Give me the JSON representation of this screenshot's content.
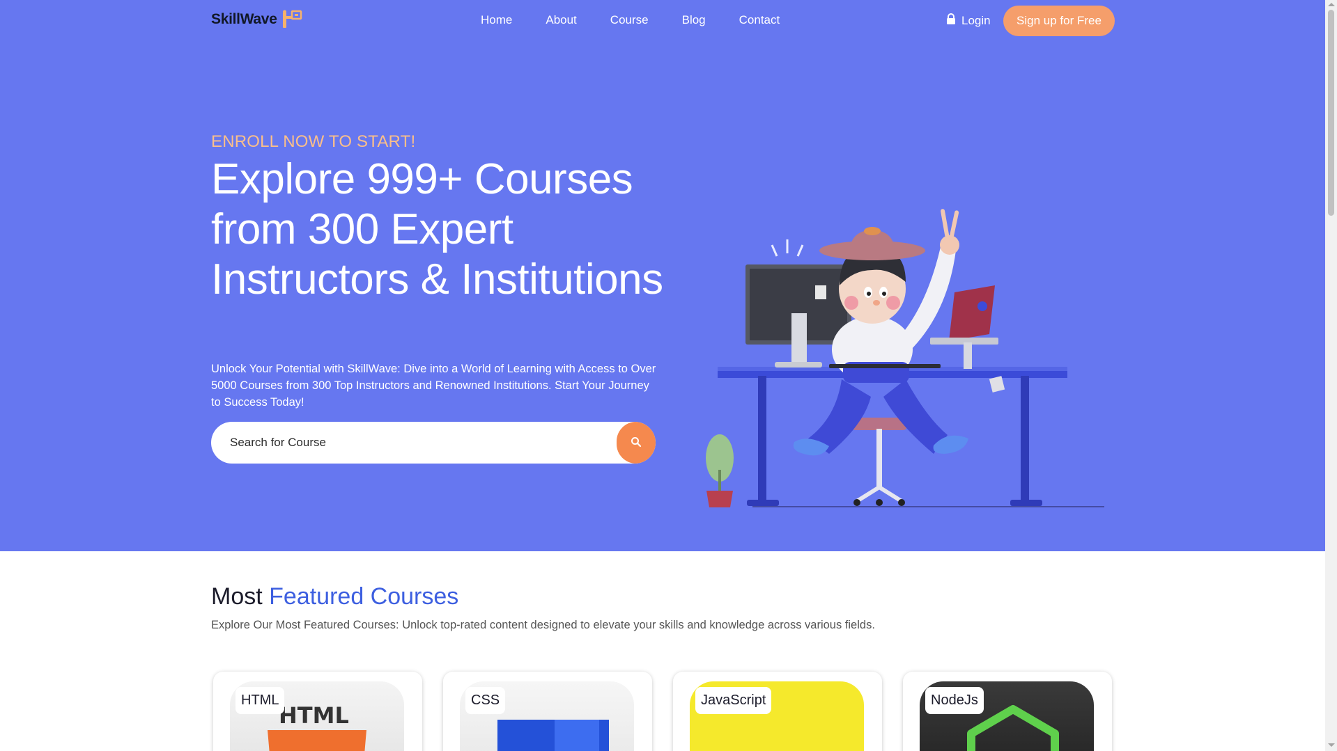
{
  "brand": {
    "name": "SkillWave",
    "color": "#111827"
  },
  "nav": {
    "links": [
      "Home",
      "About",
      "Course",
      "Blog",
      "Contact"
    ],
    "login_label": "Login",
    "signup_label": "Sign up for Free"
  },
  "hero": {
    "eyebrow": "ENROLL NOW TO START!",
    "headline": "Explore 999+ Courses from 300 Expert Instructors & Institutions",
    "subtext": "Unlock Your Potential with SkillWave: Dive into a World of Learning with Access to Over 5000 Courses from 300 Top Instructors and Renowned Institutions. Start Your Journey to Success Today!",
    "search_placeholder": "Search for Course",
    "background_color": "#6677f0"
  },
  "featured": {
    "title_plain": "Most",
    "title_accent": "Featured Courses",
    "subtitle": "Explore Our Most Featured Courses: Unlock top-rated content designed to elevate your skills and knowledge across various fields.",
    "cards": [
      {
        "label": "HTML",
        "icon": "html-logo-icon"
      },
      {
        "label": "CSS",
        "icon": "css-logo-icon"
      },
      {
        "label": "JavaScript",
        "icon": "javascript-logo-icon"
      },
      {
        "label": "NodeJs",
        "icon": "nodejs-logo-icon"
      }
    ]
  },
  "colors": {
    "accent_orange": "#f59e6b",
    "accent_blue": "#3d5fe0"
  }
}
